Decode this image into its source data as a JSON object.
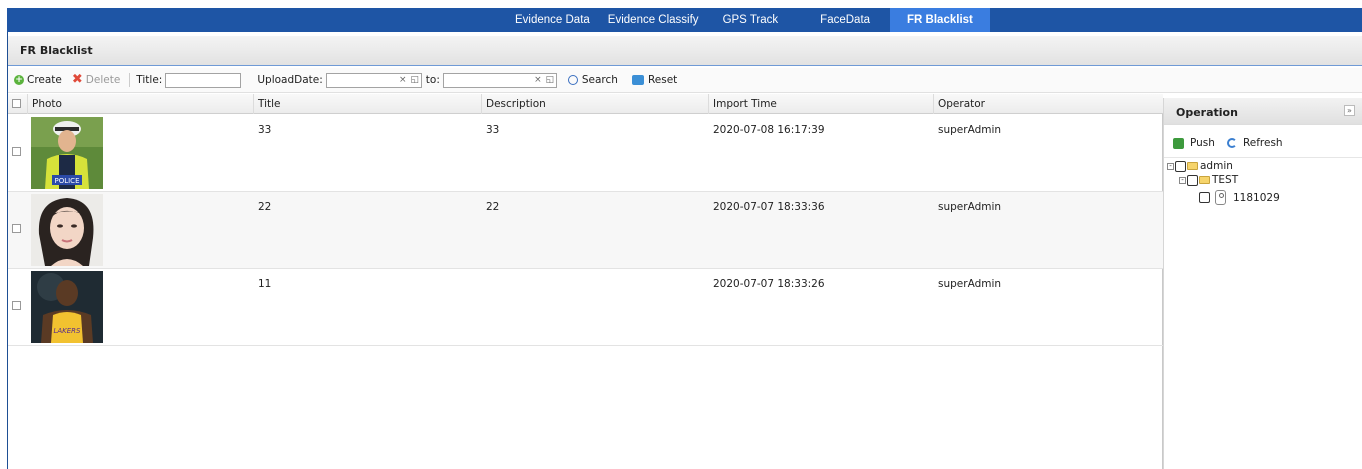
{
  "nav": {
    "tabs": [
      {
        "label": "Evidence Data",
        "active": false
      },
      {
        "label": "Evidence Classify",
        "active": false
      },
      {
        "label": "GPS Track",
        "active": false
      },
      {
        "label": "FaceData",
        "active": false
      },
      {
        "label": "FR Blacklist",
        "active": true
      }
    ],
    "bar_color": "#1e55a5",
    "active_color": "#3a7de0"
  },
  "panel": {
    "title": "FR Blacklist"
  },
  "toolbar": {
    "create_label": "Create",
    "delete_label": "Delete",
    "title_label": "Title:",
    "title_value": "",
    "upload_label": "UploadDate:",
    "upload_from": "",
    "to_label": "to:",
    "upload_to": "",
    "clear_glyph": "×",
    "search_label": "Search",
    "reset_label": "Reset"
  },
  "grid": {
    "columns": [
      "Photo",
      "Title",
      "Description",
      "Import Time",
      "Operator"
    ],
    "rows": [
      {
        "photo": "police-officer-photo",
        "title": "33",
        "description": "33",
        "import_time": "2020-07-08 16:17:39",
        "operator": "superAdmin"
      },
      {
        "photo": "woman-portrait-photo",
        "title": "22",
        "description": "22",
        "import_time": "2020-07-07 18:33:36",
        "operator": "superAdmin"
      },
      {
        "photo": "basketball-player-photo",
        "title": "11",
        "description": "",
        "import_time": "2020-07-07 18:33:26",
        "operator": "superAdmin"
      }
    ]
  },
  "side": {
    "title": "Operation",
    "collapse_glyph": "»",
    "push_label": "Push",
    "refresh_label": "Refresh",
    "tree": {
      "root": "admin",
      "child": "TEST",
      "leaf": "1181029"
    }
  }
}
